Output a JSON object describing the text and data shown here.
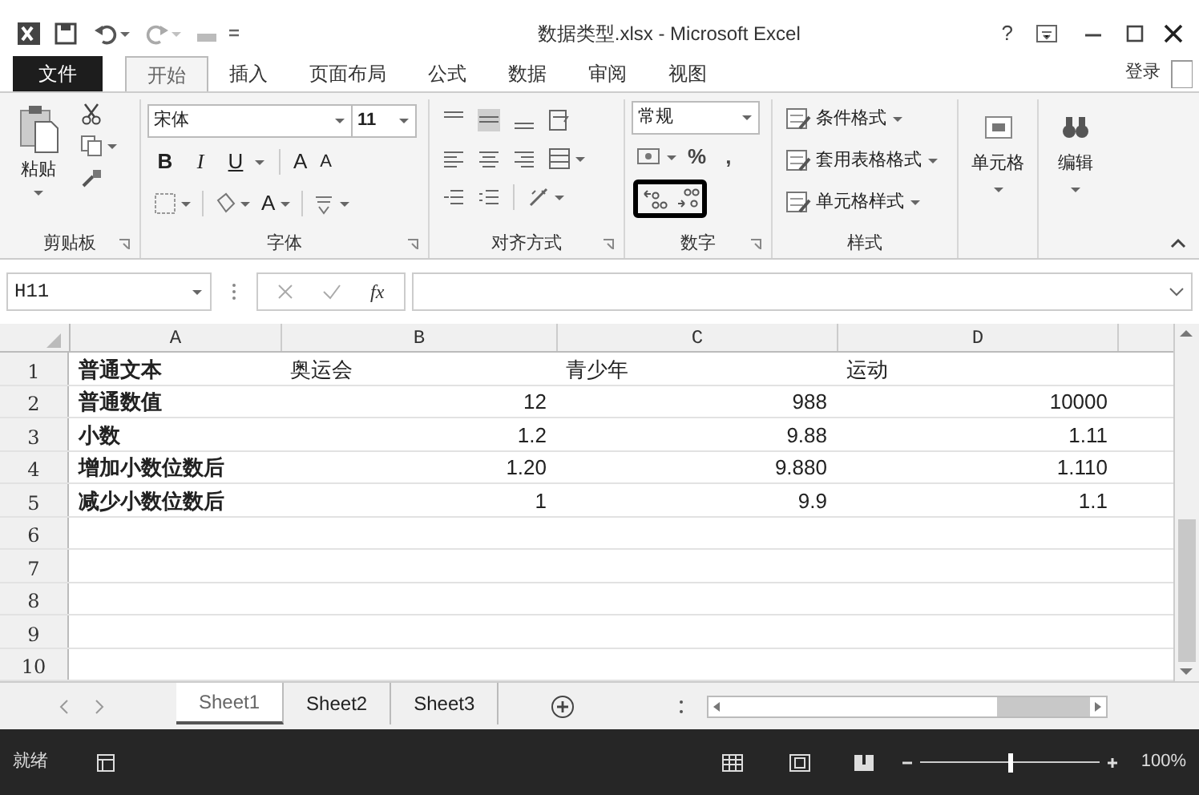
{
  "window": {
    "title": "数据类型.xlsx - Microsoft Excel",
    "help": "?"
  },
  "ribbon_tabs": [
    {
      "label": "文件",
      "kind": "file",
      "selected": false
    },
    {
      "label": "开始",
      "kind": "tab",
      "selected": true
    },
    {
      "label": "插入",
      "kind": "tab",
      "selected": false
    },
    {
      "label": "页面布局",
      "kind": "tab",
      "selected": false
    },
    {
      "label": "公式",
      "kind": "tab",
      "selected": false
    },
    {
      "label": "数据",
      "kind": "tab",
      "selected": false
    },
    {
      "label": "审阅",
      "kind": "tab",
      "selected": false
    },
    {
      "label": "视图",
      "kind": "tab",
      "selected": false
    }
  ],
  "account": "登录",
  "ribbon": {
    "clipboard": {
      "paste": "粘贴",
      "group_label": "剪贴板"
    },
    "font": {
      "font_name": "宋体",
      "font_size": "11",
      "format_buttons": [
        "B",
        "I",
        "U"
      ],
      "grow_font": "A",
      "shrink_font": "A",
      "font_color": "A",
      "group_label": "字体"
    },
    "alignment": {
      "group_label": "对齐方式"
    },
    "number": {
      "format": "常规",
      "percent": "%",
      "comma": ",",
      "decimal_buttons_highlighted": true,
      "group_label": "数字"
    },
    "styles": {
      "items": [
        "条件格式",
        "套用表格格式",
        "单元格样式"
      ],
      "group_label": "样式"
    },
    "cells": {
      "label": "单元格"
    },
    "editing": {
      "label": "编辑"
    }
  },
  "formula_bar": {
    "name_box": "H11",
    "function_label": "fx"
  },
  "sheet": {
    "columns": [
      "A",
      "B",
      "C",
      "D"
    ],
    "rows": [
      {
        "number": "1",
        "kind": "text",
        "cells": [
          "普通文本",
          "奥运会",
          "青少年",
          "运动"
        ]
      },
      {
        "number": "2",
        "kind": "number",
        "cells": [
          "普通数值",
          "12",
          "988",
          "10000"
        ]
      },
      {
        "number": "3",
        "kind": "number",
        "cells": [
          "小数",
          "1.2",
          "9.88",
          "1.11"
        ]
      },
      {
        "number": "4",
        "kind": "number",
        "cells": [
          "增加小数位数后",
          "1.20",
          "9.880",
          "1.110"
        ]
      },
      {
        "number": "5",
        "kind": "number",
        "cells": [
          "减少小数位数后",
          "1",
          "9.9",
          "1.1"
        ]
      },
      {
        "number": "6"
      },
      {
        "number": "7"
      },
      {
        "number": "8"
      },
      {
        "number": "9"
      },
      {
        "number": "10"
      }
    ]
  },
  "sheet_tabs": [
    {
      "label": "Sheet1",
      "selected": true
    },
    {
      "label": "Sheet2",
      "selected": false
    },
    {
      "label": "Sheet3",
      "selected": false
    }
  ],
  "status_bar": {
    "status": "就绪",
    "zoom": "100%",
    "zoom_level": {
      "level": 0.5
    }
  }
}
